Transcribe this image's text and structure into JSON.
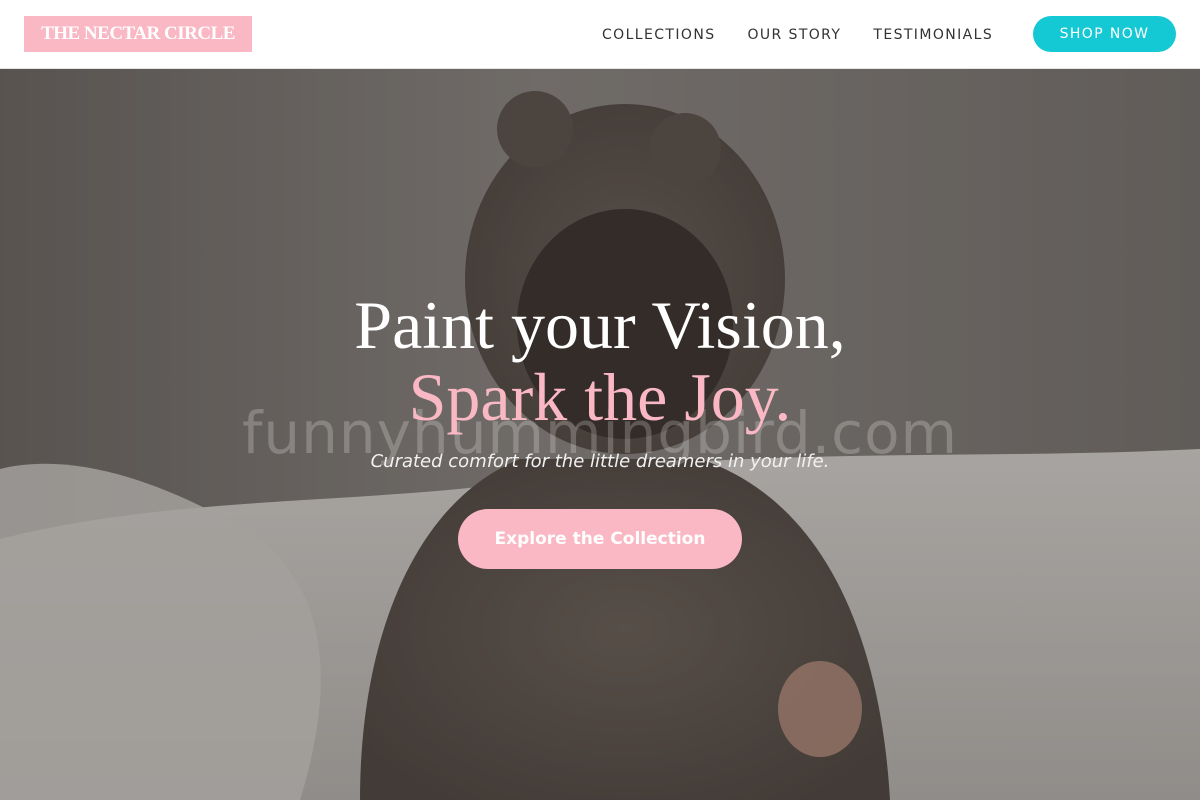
{
  "header": {
    "logo_text": "THE NECTAR CIRCLE",
    "nav": [
      {
        "label": "COLLECTIONS"
      },
      {
        "label": "OUR STORY"
      },
      {
        "label": "TESTIMONIALS"
      }
    ],
    "shop_button": "SHOP NOW"
  },
  "hero": {
    "title_line1": "Paint your Vision,",
    "title_line2": "Spark the Joy.",
    "watermark": "funnyhummingbird.com",
    "subtitle": "Curated comfort for the little dreamers in your life.",
    "cta_label": "Explore the Collection"
  },
  "colors": {
    "logo_bg": "#f9b8c3",
    "accent_pink": "#f9b8c3",
    "shop_button_bg": "#14c8d4",
    "nav_text": "#333333"
  }
}
